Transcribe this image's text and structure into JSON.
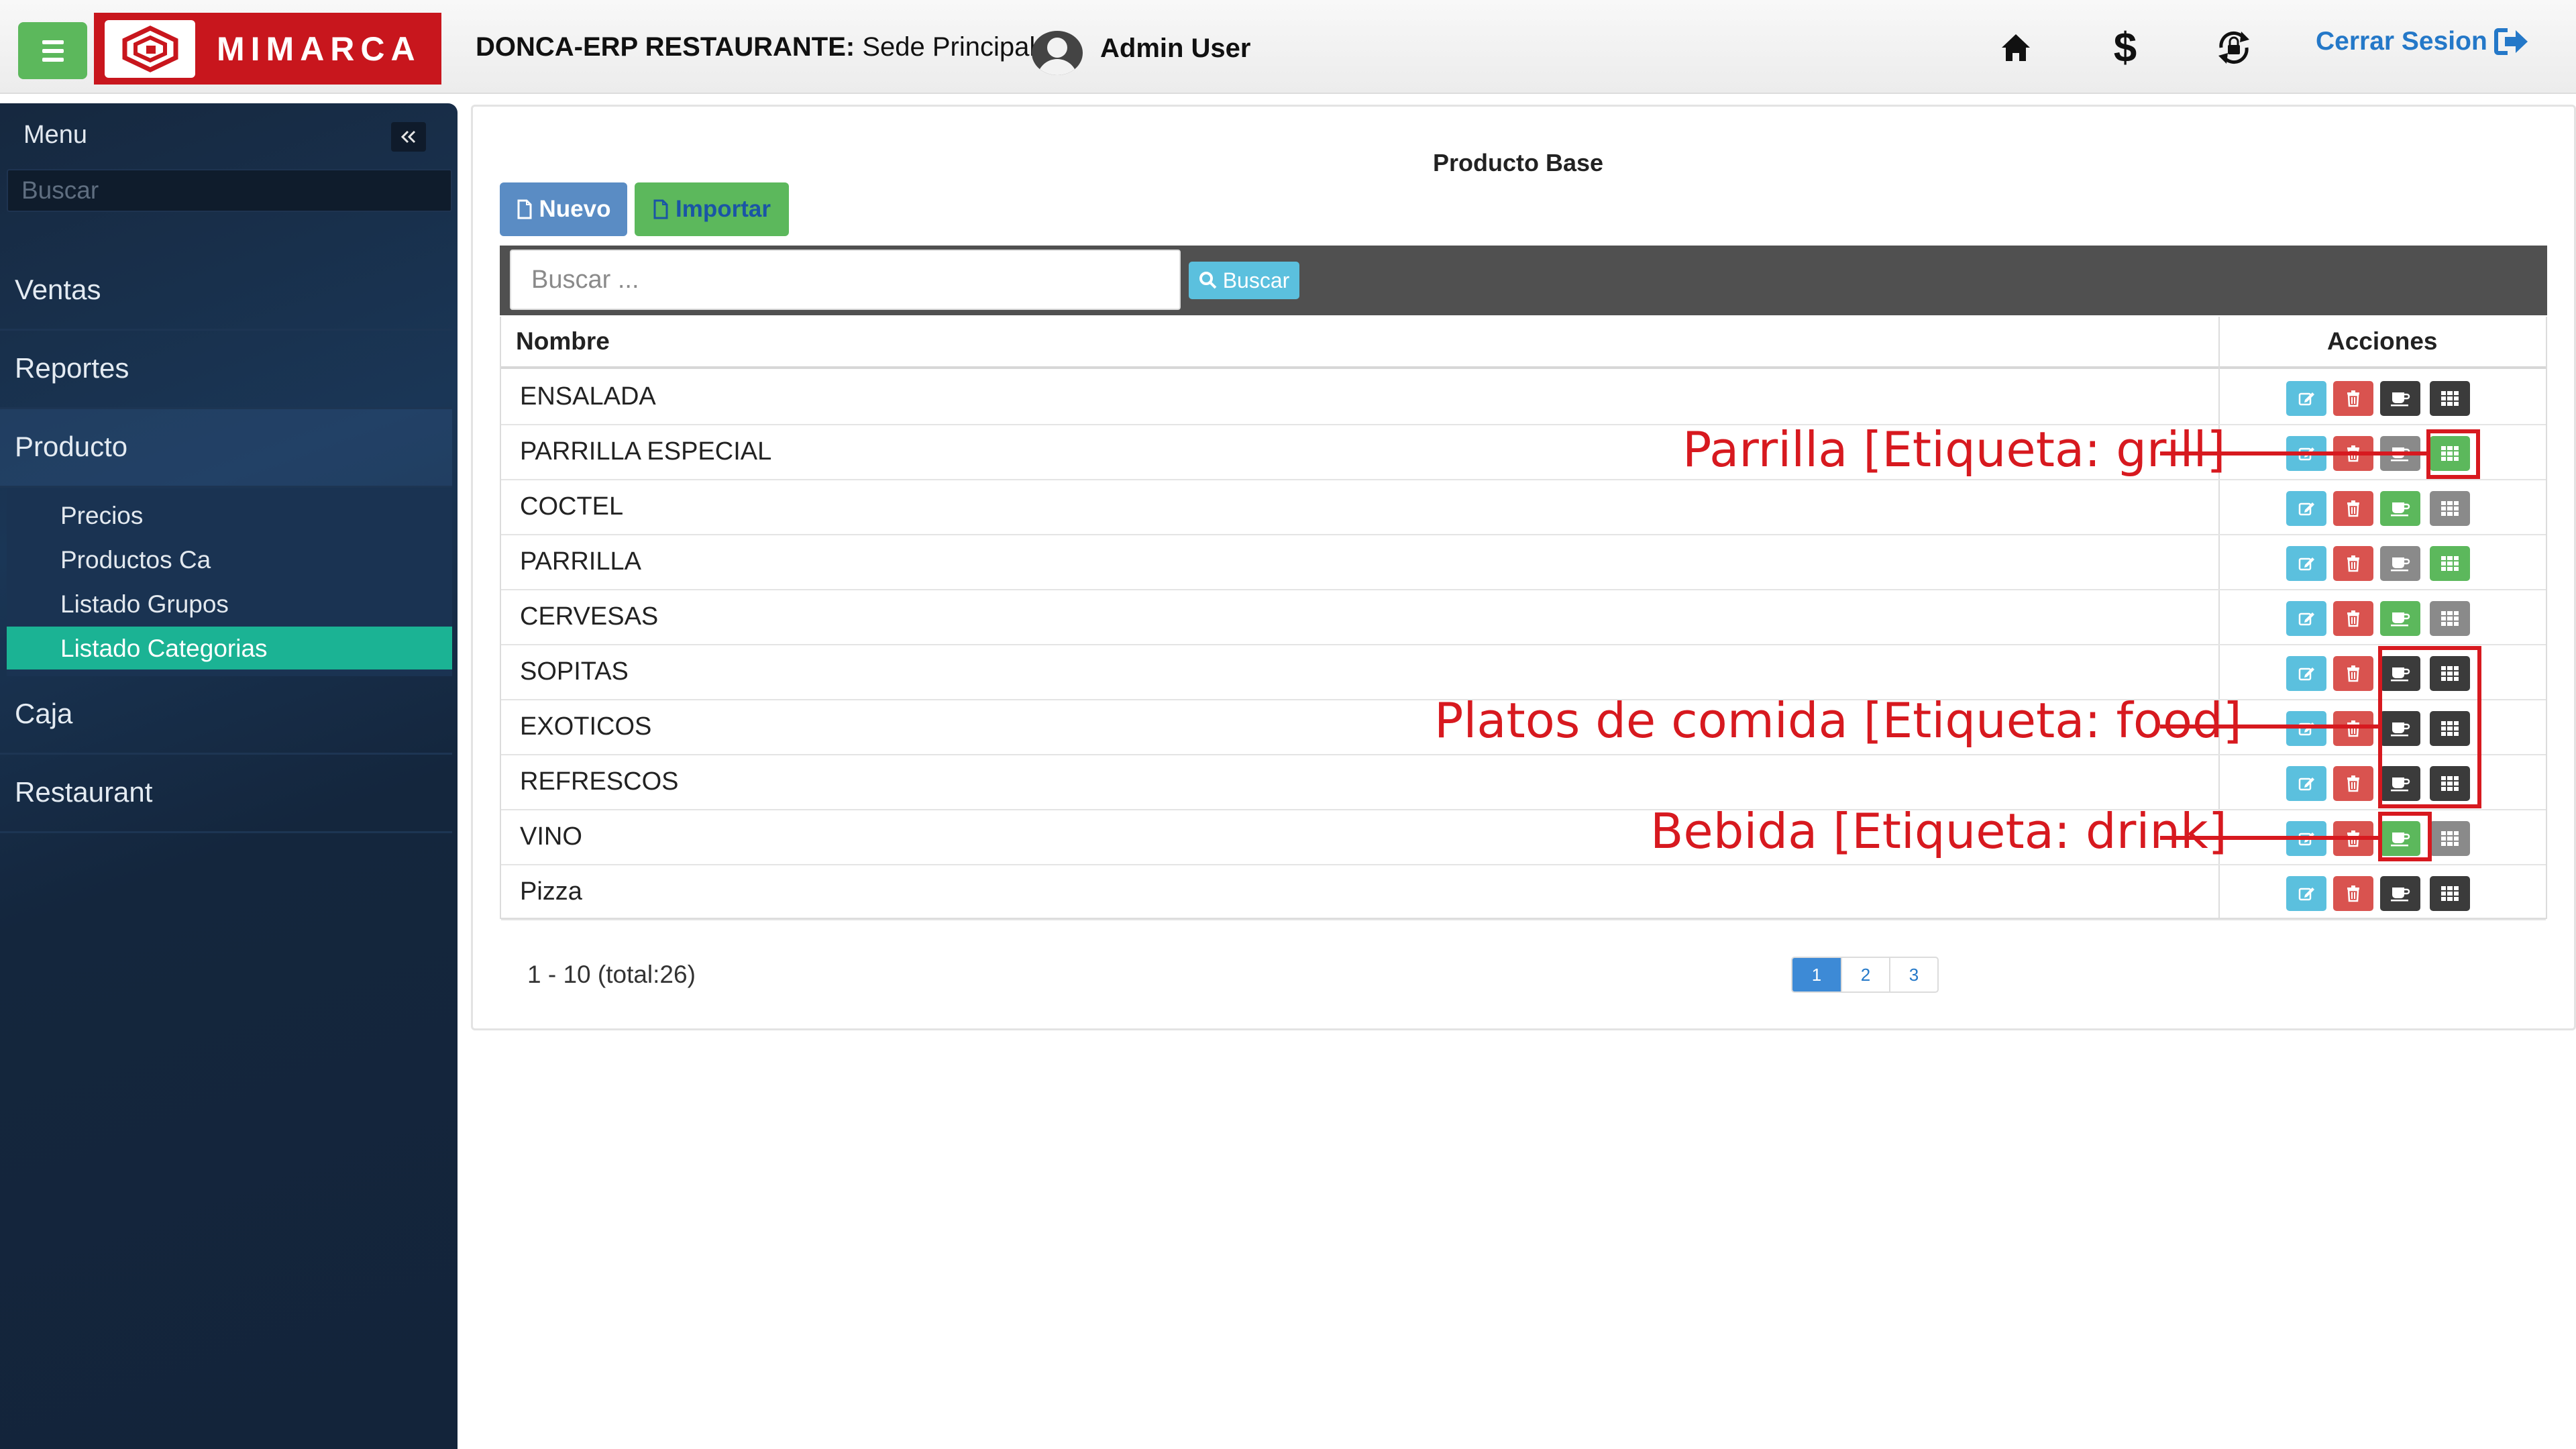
{
  "header": {
    "brand": "MIMARCA",
    "app_name": "DONCA-ERP RESTAURANTE:",
    "location": " Sede Principal | ",
    "user": "Admin User",
    "logout_label": "Cerrar Sesion"
  },
  "sidebar": {
    "title": "Menu",
    "search_placeholder": "Buscar",
    "items": [
      {
        "label": "Ventas"
      },
      {
        "label": "Reportes"
      },
      {
        "label": "Producto"
      },
      {
        "label": "Caja"
      },
      {
        "label": "Restaurant"
      }
    ],
    "sub_items": [
      {
        "label": "Precios"
      },
      {
        "label": "Productos Ca"
      },
      {
        "label": "Listado Grupos"
      },
      {
        "label": "Listado Categorias",
        "active": true
      }
    ]
  },
  "main": {
    "title": "Producto Base",
    "new_button": "Nuevo",
    "import_button": "Importar",
    "search_placeholder": "Buscar ...",
    "search_button": "Buscar",
    "table": {
      "headers": [
        "Nombre",
        "Acciones"
      ],
      "rows": [
        {
          "name": "ENSALADA"
        },
        {
          "name": "PARRILLA ESPECIAL"
        },
        {
          "name": "COCTEL"
        },
        {
          "name": "PARRILLA"
        },
        {
          "name": "CERVESAS"
        },
        {
          "name": "SOPITAS"
        },
        {
          "name": "EXOTICOS"
        },
        {
          "name": "REFRESCOS"
        },
        {
          "name": "VINO"
        },
        {
          "name": "Pizza"
        }
      ]
    },
    "pagination": {
      "info": "1 - 10 (total:26)",
      "pages": [
        "1",
        "2",
        "3"
      ],
      "current": "1"
    }
  },
  "annotations": {
    "grill": "Parrilla [Etiqueta: grill]",
    "food": "Platos de comida [Etiqueta: food]",
    "drink": "Bebida [Etiqueta: drink]"
  },
  "colors": {
    "edit": "#5bc0de",
    "delete": "#d9534f",
    "active_green": "#5cb85c",
    "dark": "#3b3b3b",
    "inactive_gray": "#8a8a8a",
    "sidebar_active": "#1bb394",
    "annotation_red": "#d7191f"
  }
}
